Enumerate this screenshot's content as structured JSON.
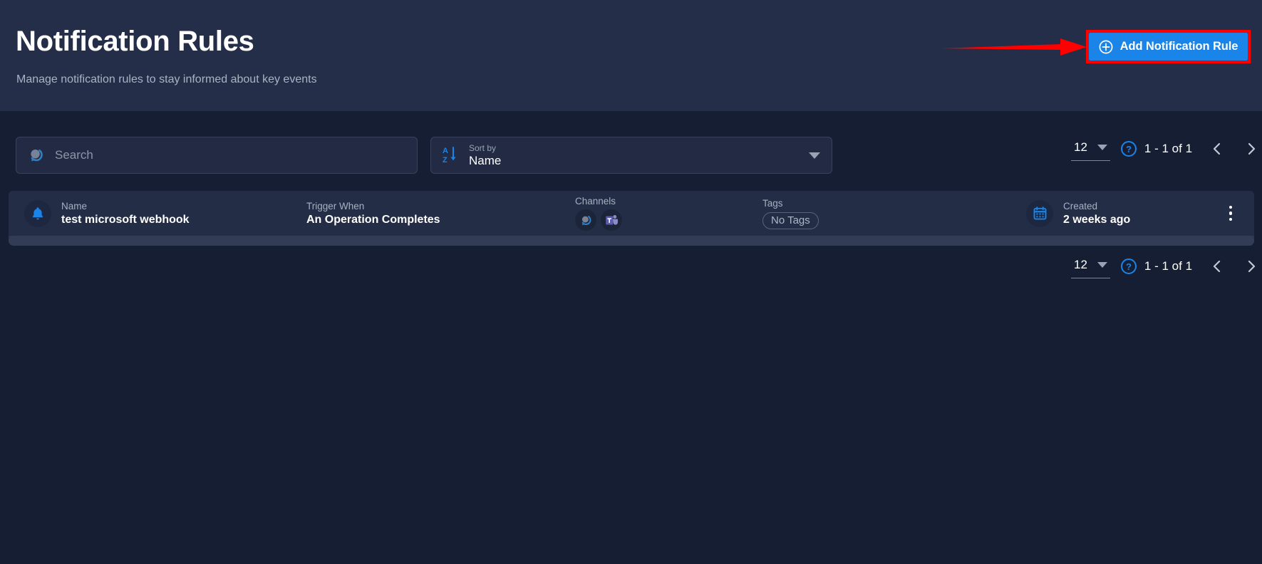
{
  "header": {
    "title": "Notification Rules",
    "subtitle": "Manage notification rules to stay informed about key events",
    "add_button_label": "Add Notification Rule",
    "add_button_icon": "plus-circle-icon",
    "band_color": "#252E48",
    "accent_color": "#1A84E8",
    "highlight_color": "#FF0000"
  },
  "toolbar": {
    "search": {
      "placeholder": "Search",
      "value": "",
      "icon": "search-icon"
    },
    "sort": {
      "label": "Sort by",
      "value": "Name",
      "icon": "sort-alpha-down-icon",
      "caret": "chevron-down-icon"
    }
  },
  "pagination": {
    "page_size": "12",
    "range": "1 - 1 of 1",
    "help_icon": "question-circle-icon",
    "prev_icon": "chevron-left-icon",
    "next_icon": "chevron-right-icon"
  },
  "table": {
    "columns": [
      "Name",
      "Trigger When",
      "Channels",
      "Tags",
      "Created"
    ],
    "rows": [
      {
        "icon": "bell-icon",
        "name_label": "Name",
        "name_value": "test microsoft webhook",
        "trigger_label": "Trigger When",
        "trigger_value": "An Operation Completes",
        "channels_label": "Channels",
        "channels": [
          "webhook-icon",
          "microsoft-teams-icon"
        ],
        "tags_label": "Tags",
        "tags_value": "No Tags",
        "created_label": "Created",
        "created_value": "2 weeks ago",
        "menu_icon": "kebab-menu-icon"
      }
    ]
  },
  "colors": {
    "page_background": "#161E33",
    "row_background": "#242D46",
    "field_background": "#222B43",
    "blue": "#1A84E8",
    "teams_purple": "#6264A7"
  }
}
